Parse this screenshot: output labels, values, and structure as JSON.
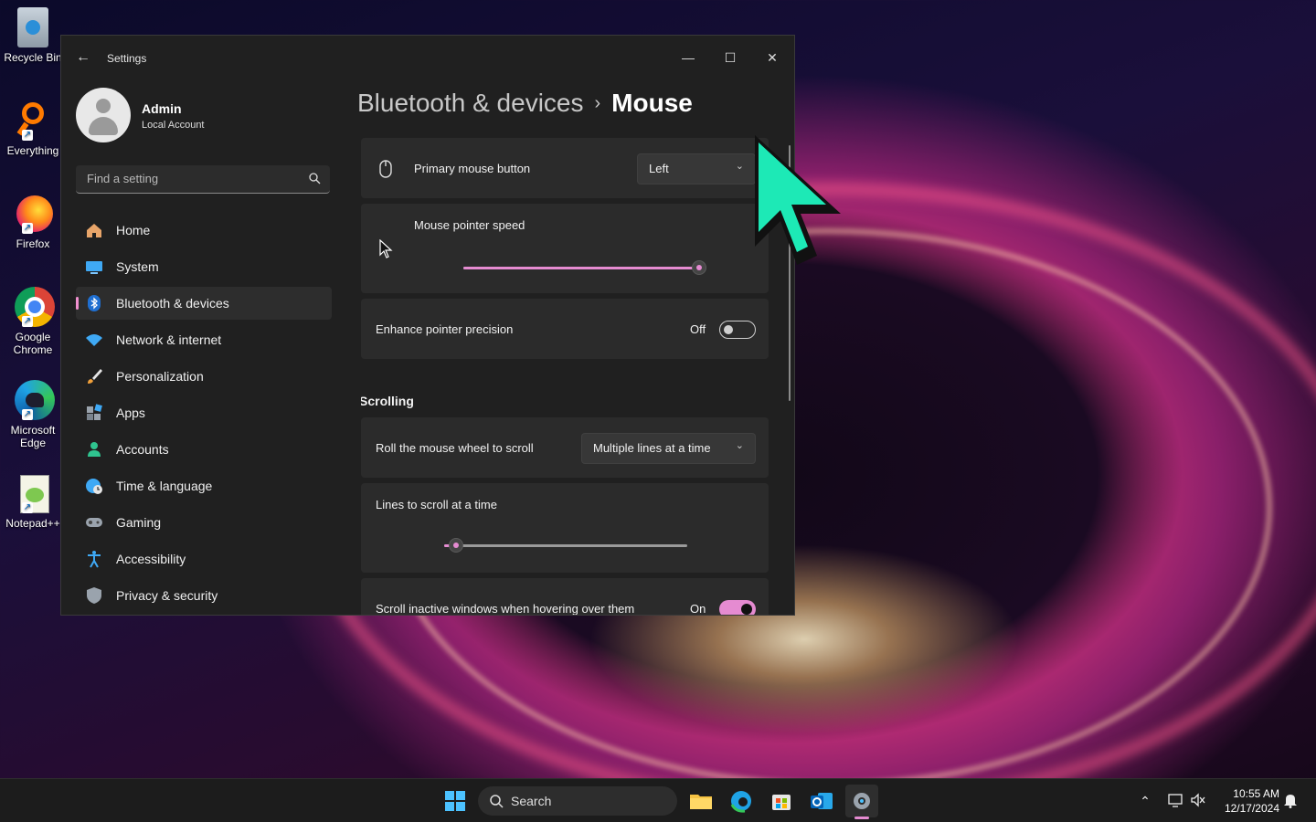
{
  "desktop": {
    "icons": [
      {
        "label": "Recycle Bin",
        "name": "recycle-bin-icon"
      },
      {
        "label": "Everything",
        "name": "everything-icon"
      },
      {
        "label": "Firefox",
        "name": "firefox-icon"
      },
      {
        "label": "Google Chrome",
        "name": "chrome-icon"
      },
      {
        "label": "Microsoft Edge",
        "name": "edge-icon"
      },
      {
        "label": "Notepad++",
        "name": "notepadpp-icon"
      }
    ]
  },
  "window": {
    "title": "Settings",
    "controls": {
      "minimize": "—",
      "maximize": "☐",
      "close": "✕"
    }
  },
  "profile": {
    "name": "Admin",
    "account_type": "Local Account"
  },
  "search": {
    "placeholder": "Find a setting"
  },
  "nav": {
    "items": [
      {
        "label": "Home",
        "icon": "home-icon",
        "active": false
      },
      {
        "label": "System",
        "icon": "system-icon",
        "active": false
      },
      {
        "label": "Bluetooth & devices",
        "icon": "bluetooth-icon",
        "active": true
      },
      {
        "label": "Network & internet",
        "icon": "wifi-icon",
        "active": false
      },
      {
        "label": "Personalization",
        "icon": "brush-icon",
        "active": false
      },
      {
        "label": "Apps",
        "icon": "apps-icon",
        "active": false
      },
      {
        "label": "Accounts",
        "icon": "accounts-icon",
        "active": false
      },
      {
        "label": "Time & language",
        "icon": "globe-clock-icon",
        "active": false
      },
      {
        "label": "Gaming",
        "icon": "gamepad-icon",
        "active": false
      },
      {
        "label": "Accessibility",
        "icon": "accessibility-icon",
        "active": false
      },
      {
        "label": "Privacy & security",
        "icon": "shield-icon",
        "active": false
      }
    ]
  },
  "breadcrumb": {
    "parent": "Bluetooth & devices",
    "separator": "›",
    "current": "Mouse"
  },
  "settings": {
    "primary_button": {
      "label": "Primary mouse button",
      "value": "Left"
    },
    "pointer_speed": {
      "label": "Mouse pointer speed",
      "level": 1.0
    },
    "enhance_precision": {
      "label": "Enhance pointer precision",
      "state_text": "Off",
      "on": false
    },
    "scrolling_heading": "Scrolling",
    "wheel_scroll": {
      "label": "Roll the mouse wheel to scroll",
      "value": "Multiple lines at a time"
    },
    "lines_to_scroll": {
      "label": "Lines to scroll at a time",
      "level": 0.05
    },
    "scroll_inactive": {
      "label": "Scroll inactive windows when hovering over them",
      "state_text": "On",
      "on": true
    }
  },
  "taskbar": {
    "search_label": "Search",
    "time": "10:55 AM",
    "date": "12/17/2024"
  },
  "colors": {
    "accent": "#e58bd1",
    "big_cursor": "#1de9b6"
  }
}
